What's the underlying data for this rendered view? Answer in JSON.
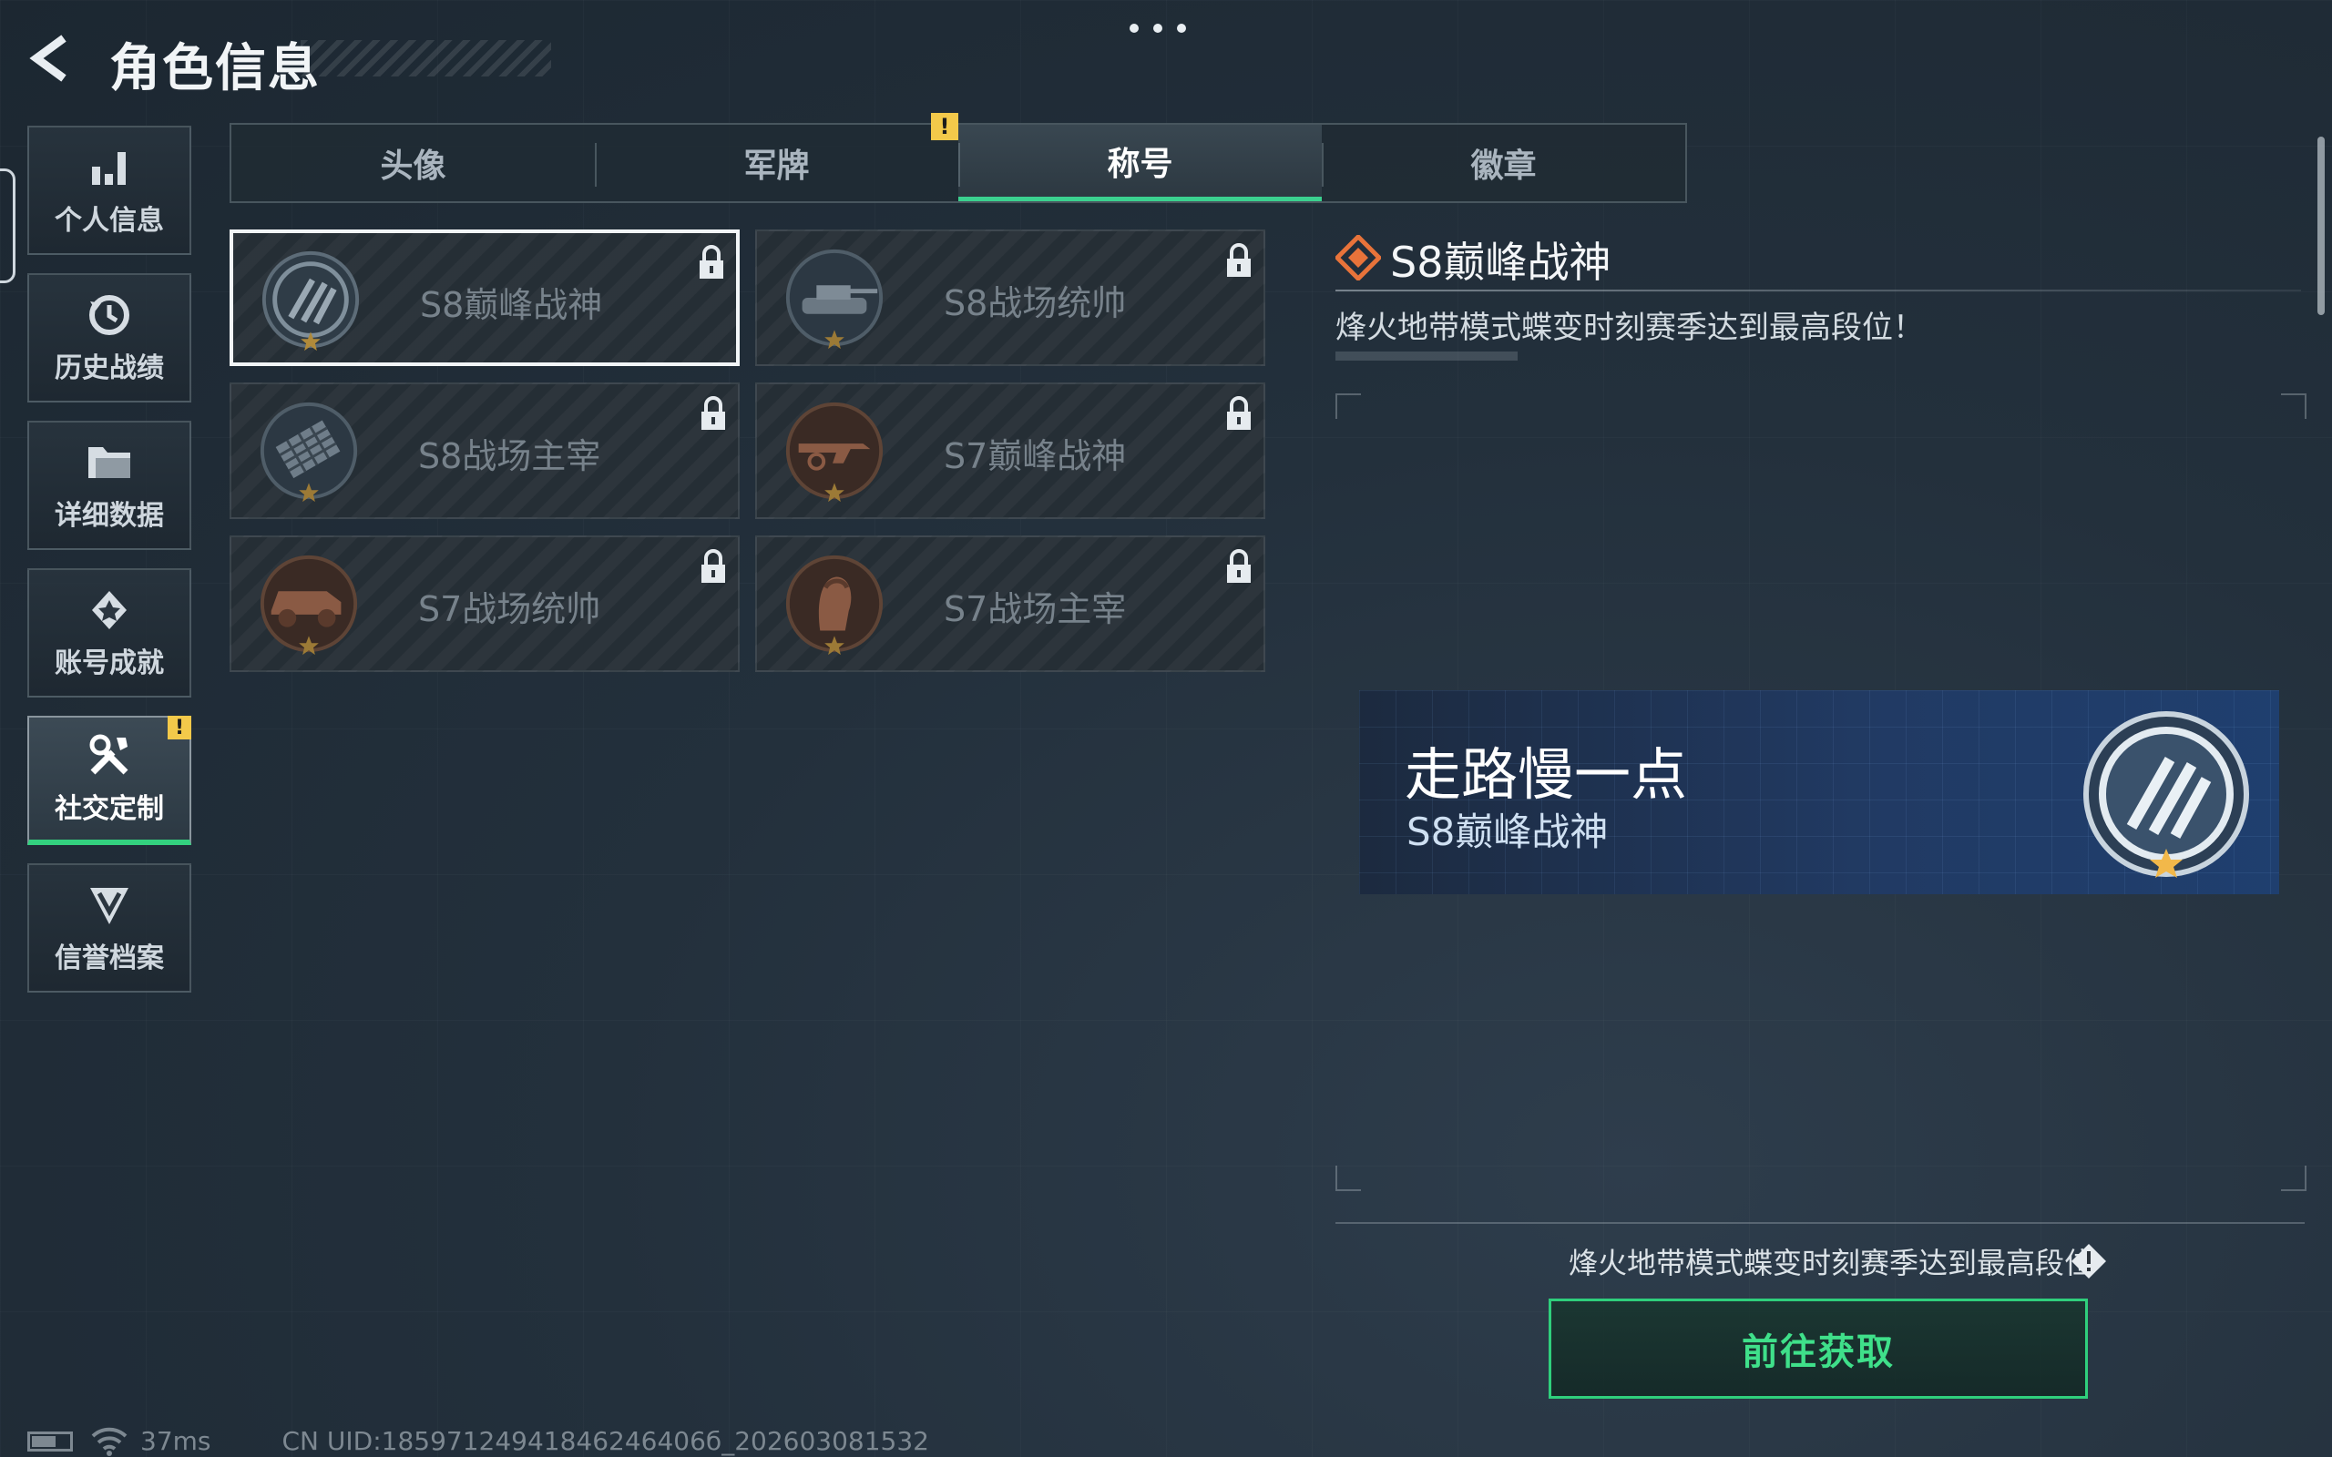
{
  "header": {
    "title": "角色信息"
  },
  "sidebar": {
    "items": [
      {
        "label": "个人信息",
        "icon": "bar-chart-icon"
      },
      {
        "label": "历史战绩",
        "icon": "history-clock-icon"
      },
      {
        "label": "详细数据",
        "icon": "folder-icon"
      },
      {
        "label": "账号成就",
        "icon": "achievement-icon"
      },
      {
        "label": "社交定制",
        "icon": "tools-icon",
        "active": true,
        "alert": "!"
      },
      {
        "label": "信誉档案",
        "icon": "shield-v-icon"
      }
    ]
  },
  "tabs": [
    {
      "label": "头像"
    },
    {
      "label": "军牌",
      "alert": "!"
    },
    {
      "label": "称号",
      "active": true
    },
    {
      "label": "徽章"
    }
  ],
  "titles": [
    {
      "name": "S8巅峰战神",
      "selected": true,
      "locked": true,
      "badge": "peak-emblem-icon"
    },
    {
      "name": "S8战场统帅",
      "locked": true,
      "badge": "tank-emblem-icon"
    },
    {
      "name": "S8战场主宰",
      "locked": true,
      "badge": "rocket-emblem-icon"
    },
    {
      "name": "S7巅峰战神",
      "locked": true,
      "badge": "rifle-emblem-icon"
    },
    {
      "name": "S7战场统帅",
      "locked": true,
      "badge": "vehicle-emblem-icon"
    },
    {
      "name": "S7战场主宰",
      "locked": true,
      "badge": "soldier-emblem-icon"
    }
  ],
  "detail": {
    "title": "S8巅峰战神",
    "description": "烽火地带模式蝶变时刻赛季达到最高段位！",
    "preview": {
      "player_name": "走路慢一点",
      "title": "S8巅峰战神"
    },
    "condition": "烽火地带模式蝶变时刻赛季达到最高段位",
    "button_label": "前往获取"
  },
  "status_bar": {
    "ping": "37ms",
    "uid": "CN UID:18597124941846246406б_202603081532"
  },
  "colors": {
    "accent": "#33d17f",
    "alert": "#f3c94a",
    "title_icon": "#e8733a"
  }
}
